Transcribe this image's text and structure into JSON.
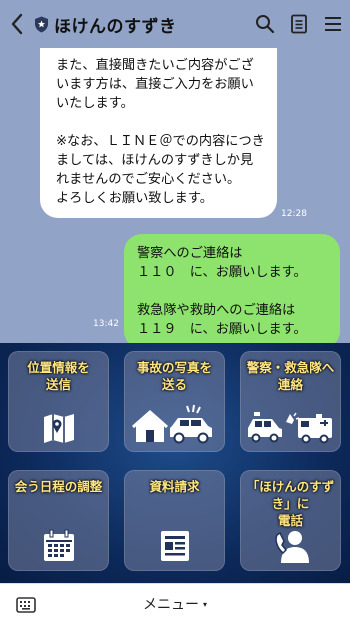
{
  "header": {
    "title": "ほけんのすずき"
  },
  "messages": {
    "incoming": {
      "text": "また、直接聞きたいご内容がございます方は、直接ご入力をお願いいたします。\n\n※なお、ＬＩＮＥ＠での内容につきましては、ほけんのすずきしか見れませんのでご安心ください。\nよろしくお願い致します。",
      "time": "12:28"
    },
    "outgoing": {
      "text": "警察へのご連絡は\n１１０　に、お願いします。\n\n救急隊や救助へのご連絡は\n１１９　に、お願いします。",
      "time": "13:42"
    }
  },
  "richmenu": {
    "tiles": [
      {
        "label": "位置情報を\n送信",
        "icon": "map-location-icon"
      },
      {
        "label": "事故の写真を\n送る",
        "icon": "accident-house-car-icon"
      },
      {
        "label": "警察・救急隊へ\n連絡",
        "icon": "police-ambulance-icon"
      },
      {
        "label": "会う日程の調整",
        "icon": "calendar-icon"
      },
      {
        "label": "資料請求",
        "icon": "document-icon"
      },
      {
        "label": "「ほけんのすずき」に\n電話",
        "icon": "phone-person-icon"
      }
    ]
  },
  "bottombar": {
    "menu_label": "メニュー",
    "menu_caret": "▾"
  }
}
